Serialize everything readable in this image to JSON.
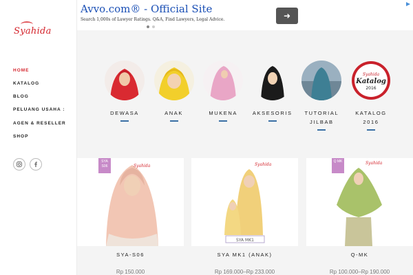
{
  "ad": {
    "title": "Avvo.com® - Official Site",
    "subtitle": "Search 1,000s of Lawyer Ratings. Q&A, Find Lawyers, Legal Advice.",
    "arrow_icon": "arrow-right-icon"
  },
  "sidebar": {
    "logo": "Syahida",
    "nav": [
      {
        "label": "HOME",
        "active": true
      },
      {
        "label": "KATALOG"
      },
      {
        "label": "BLOG"
      },
      {
        "label": "PELUANG USAHA :",
        "sub": "AGEN & RESELLER"
      },
      {
        "label": "SHOP"
      }
    ],
    "social": [
      "instagram-icon",
      "facebook-icon"
    ]
  },
  "categories": [
    {
      "label": "DEWASA"
    },
    {
      "label": "ANAK"
    },
    {
      "label": "MUKENA"
    },
    {
      "label": "AKSESORIS"
    },
    {
      "label": "TUTORIAL",
      "label2": "JILBAB"
    },
    {
      "label": "KATALOG",
      "label2": "2016",
      "badge_brand": "Syahida",
      "badge_title": "Katalog",
      "badge_year": "2016"
    }
  ],
  "products": [
    {
      "name": "SYA-S06",
      "price": "Rp 150.000",
      "tag": "SYA S06",
      "brand": "Syahida"
    },
    {
      "name": "SYA MK1 (ANAK)",
      "price": "Rp 169.000–Rp 233.000",
      "brand": "Syahida",
      "caption": "SYA MK1"
    },
    {
      "name": "Q-MK",
      "price": "Rp 100.000–Rp 190.000",
      "tag": "Q MK",
      "brand": "Syahida"
    }
  ],
  "colors": {
    "accent": "#d4242c",
    "underline": "#3a6fa5",
    "ad_title": "#1a4fb5",
    "tag": "#c78ac8"
  }
}
